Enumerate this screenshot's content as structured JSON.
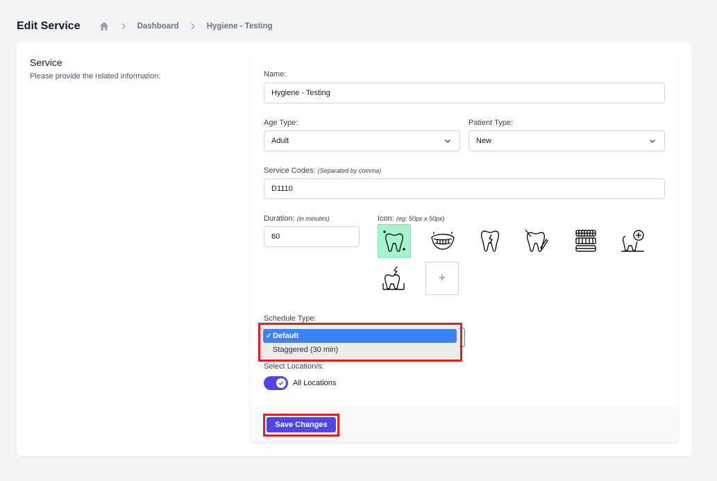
{
  "header": {
    "title": "Edit Service",
    "breadcrumb": [
      "Dashboard",
      "Hygiene - Testing"
    ]
  },
  "section": {
    "title": "Service",
    "description": "Please provide the related information:"
  },
  "form": {
    "name_label": "Name:",
    "name_value": "Hygiene - Testing",
    "age_type_label": "Age Type:",
    "age_type_value": "Adult",
    "patient_type_label": "Patient Type:",
    "patient_type_value": "New",
    "service_codes_label": "Service Codes:",
    "service_codes_hint": "(Separated by comma)",
    "service_codes_value": "D1110",
    "duration_label": "Duration:",
    "duration_hint": "(in minutes)",
    "duration_value": "60",
    "icon_label": "Icon:",
    "icon_hint": "(eg: 50px x 50px)",
    "icons": [
      "tooth-sparkle-icon",
      "teeth-smile-icon",
      "cracked-tooth-icon",
      "tooth-tool-icon",
      "dentures-icon",
      "tooth-plus-icon",
      "tooth-lightning-icon"
    ],
    "add_icon_glyph": "+",
    "schedule_type_label": "Schedule Type:",
    "schedule_options": [
      {
        "label": "Default",
        "selected": true
      },
      {
        "label": "Staggered (30 min)",
        "selected": false
      }
    ],
    "location_label": "Select Location/s:",
    "all_locations_label": "All Locations",
    "all_locations_on": true
  },
  "footer": {
    "save_label": "Save Changes"
  },
  "colors": {
    "accent": "#4f46e5",
    "selected_icon_bg": "#a7f3d0",
    "highlight": "#e02020",
    "dropdown_active": "#3b82f6"
  }
}
